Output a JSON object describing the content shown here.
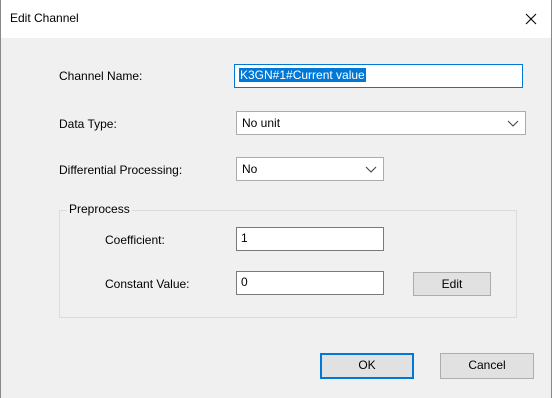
{
  "dialog": {
    "title": "Edit Channel",
    "close_icon": "close-icon"
  },
  "fields": {
    "channel_name_label": "Channel Name:",
    "channel_name_value": "K3GN#1#Current value",
    "data_type_label": "Data Type:",
    "data_type_value": "No unit",
    "differential_label": "Differential Processing:",
    "differential_value": "No"
  },
  "preprocess": {
    "group_title": "Preprocess",
    "coefficient_label": "Coefficient:",
    "coefficient_value": "1",
    "constant_label": "Constant Value:",
    "constant_value": "0",
    "edit_label": "Edit"
  },
  "buttons": {
    "ok_label": "OK",
    "cancel_label": "Cancel"
  },
  "colors": {
    "accent": "#0078d7",
    "dialog_bg": "#f0f0f0",
    "button_bg": "#e1e1e1"
  }
}
